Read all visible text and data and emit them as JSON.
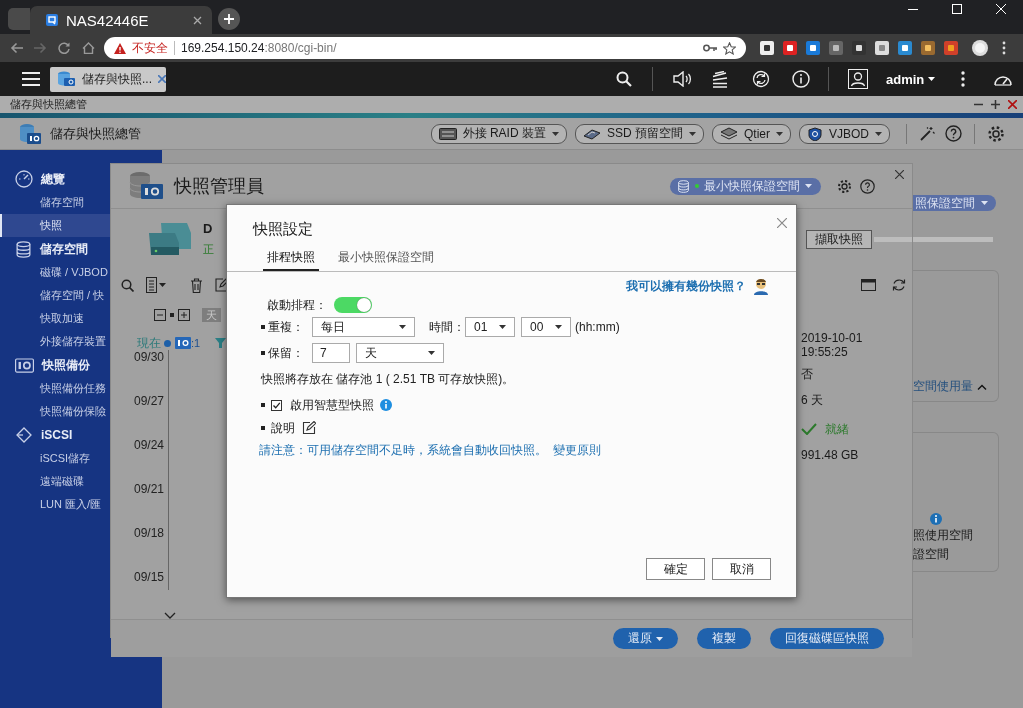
{
  "browser": {
    "tab_title": "NAS42446E",
    "security": "不安全",
    "host": "169.254.150.24",
    "path": ":8080/cgi-bin/"
  },
  "qts_bar": {
    "app_tab": "儲存與快照...",
    "user": "admin"
  },
  "app": {
    "window_title": "儲存與快照總管",
    "title": "儲存與快照總管",
    "header_buttons": [
      {
        "kind": "raid",
        "label": "外接 RAID 裝置"
      },
      {
        "kind": "ssd",
        "label": "SSD 預留空間"
      },
      {
        "kind": "qtier",
        "label": "Qtier"
      },
      {
        "kind": "vjbod",
        "label": "VJBOD"
      }
    ]
  },
  "sidebar": [
    {
      "label": "總覽",
      "children": [
        {
          "label": "儲存空間",
          "selected": false
        },
        {
          "label": "快照",
          "selected": true
        }
      ]
    },
    {
      "label": "儲存空間",
      "children": [
        {
          "label": "磁碟 / VJBOD",
          "selected": false
        },
        {
          "label": "儲存空間 / 快",
          "selected": false
        },
        {
          "label": "快取加速",
          "selected": false
        },
        {
          "label": "外接儲存裝置",
          "selected": false
        }
      ]
    },
    {
      "label": "快照備份",
      "children": [
        {
          "label": "快照備份任務",
          "selected": false
        },
        {
          "label": "快照備份保險",
          "selected": false
        }
      ]
    },
    {
      "label": "iSCSI",
      "children": [
        {
          "label": "iSCSI儲存",
          "selected": false
        },
        {
          "label": "遠端磁碟",
          "selected": false
        },
        {
          "label": "LUN 匯入/匯",
          "selected": false
        }
      ]
    }
  ],
  "background_panel": {
    "guarantee_button": "照保證空間",
    "usage_link": "空間使用量",
    "space_lines": [
      "照使用空間",
      "證空間"
    ]
  },
  "snapshot_manager": {
    "title": "快照管理員",
    "guarantee_button": "最小快照保證空間",
    "volume_name": "D",
    "volume_status": "正",
    "take_snapshot_button": "擷取快照",
    "timeline": {
      "unit": "天",
      "now": "現在",
      "count": ":1",
      "dates": [
        "09/30",
        "09/27",
        "09/24",
        "09/21",
        "09/18",
        "09/15"
      ]
    },
    "details": [
      "2019-10-01",
      "19:55:25",
      "否",
      "6 天"
    ],
    "status": "就緒",
    "size": "991.48 GB",
    "buttons": [
      {
        "label": "還原",
        "dropdown": true
      },
      {
        "label": "複製",
        "dropdown": false
      },
      {
        "label": "回復磁碟區快照",
        "dropdown": false
      }
    ]
  },
  "dialog": {
    "title": "快照設定",
    "tabs": [
      {
        "label": "排程快照",
        "selected": true
      },
      {
        "label": "最小快照保證空間",
        "selected": false
      }
    ],
    "help_link": "我可以擁有幾份快照？",
    "enable": {
      "label": "啟動排程：",
      "on": true
    },
    "repeat": {
      "label": "重複：",
      "value": "每日"
    },
    "time": {
      "label": "時間：",
      "hour": "01",
      "minute": "00",
      "format": "(hh:mm)"
    },
    "retain": {
      "label": "保留：",
      "value": "7",
      "unit": "天"
    },
    "storage_note": "快照將存放在 儲存池 1 ( 2.51 TB 可存放快照)。",
    "smart": {
      "label": "啟用智慧型快照",
      "checked": true
    },
    "description_label": "說明",
    "notice": "請注意：可用儲存空間不足時，系統會自動收回快照。",
    "notice_link": "變更原則",
    "buttons": [
      "確定",
      "取消"
    ]
  }
}
